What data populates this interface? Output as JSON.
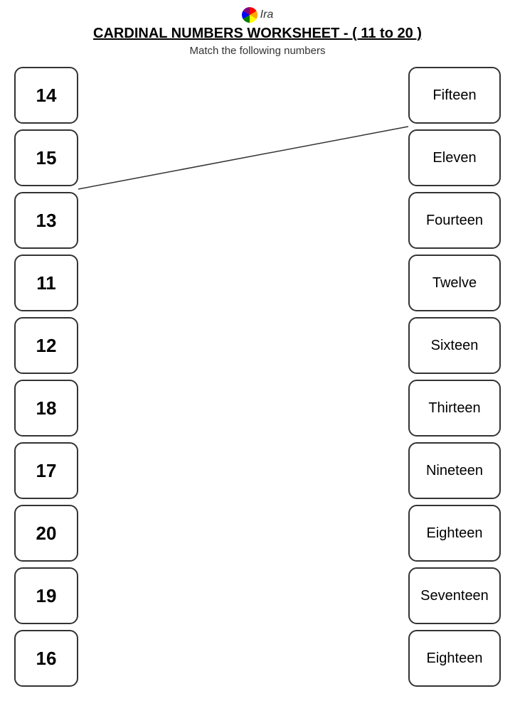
{
  "header": {
    "logo_text": "Ira",
    "title": "CARDINAL NUMBERS WORKSHEET - ( 11 to 20 )",
    "subtitle": "Match the following numbers"
  },
  "left_numbers": [
    "14",
    "15",
    "13",
    "11",
    "12",
    "18",
    "17",
    "20",
    "19",
    "16"
  ],
  "right_words": [
    "Fifteen",
    "Eleven",
    "Fourteen",
    "Twelve",
    "Sixteen",
    "Thirteen",
    "Nineteen",
    "Eighteen",
    "Seventeen",
    "Eighteen"
  ]
}
